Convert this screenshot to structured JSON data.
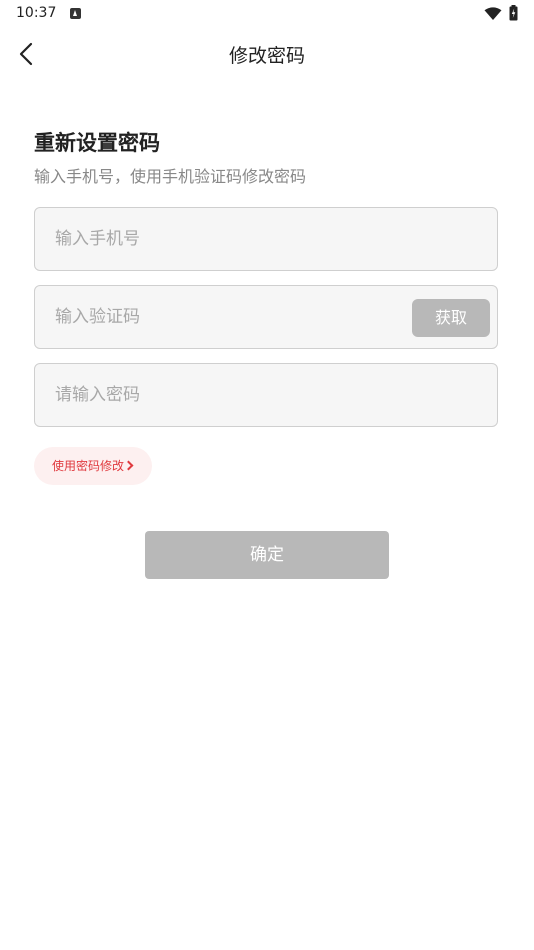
{
  "status_bar": {
    "time": "10:37",
    "icons": [
      "notification-a-icon",
      "wifi-icon",
      "battery-charging-icon"
    ]
  },
  "nav": {
    "title": "修改密码",
    "back_icon": "chevron-left-icon"
  },
  "form": {
    "heading": "重新设置密码",
    "subheading": "输入手机号，使用手机验证码修改密码",
    "phone": {
      "placeholder": "输入手机号",
      "value": ""
    },
    "code": {
      "placeholder": "输入验证码",
      "value": "",
      "get_code_label": "获取"
    },
    "password": {
      "placeholder": "请输入密码",
      "value": ""
    },
    "switch_mode_label": "使用密码修改",
    "confirm_label": "确定"
  },
  "colors": {
    "accent": "#e0393e",
    "disabled_button": "#b8b8b8",
    "input_background": "#f6f6f6",
    "input_border": "#cfcfcf",
    "placeholder": "#a8a8a8"
  }
}
